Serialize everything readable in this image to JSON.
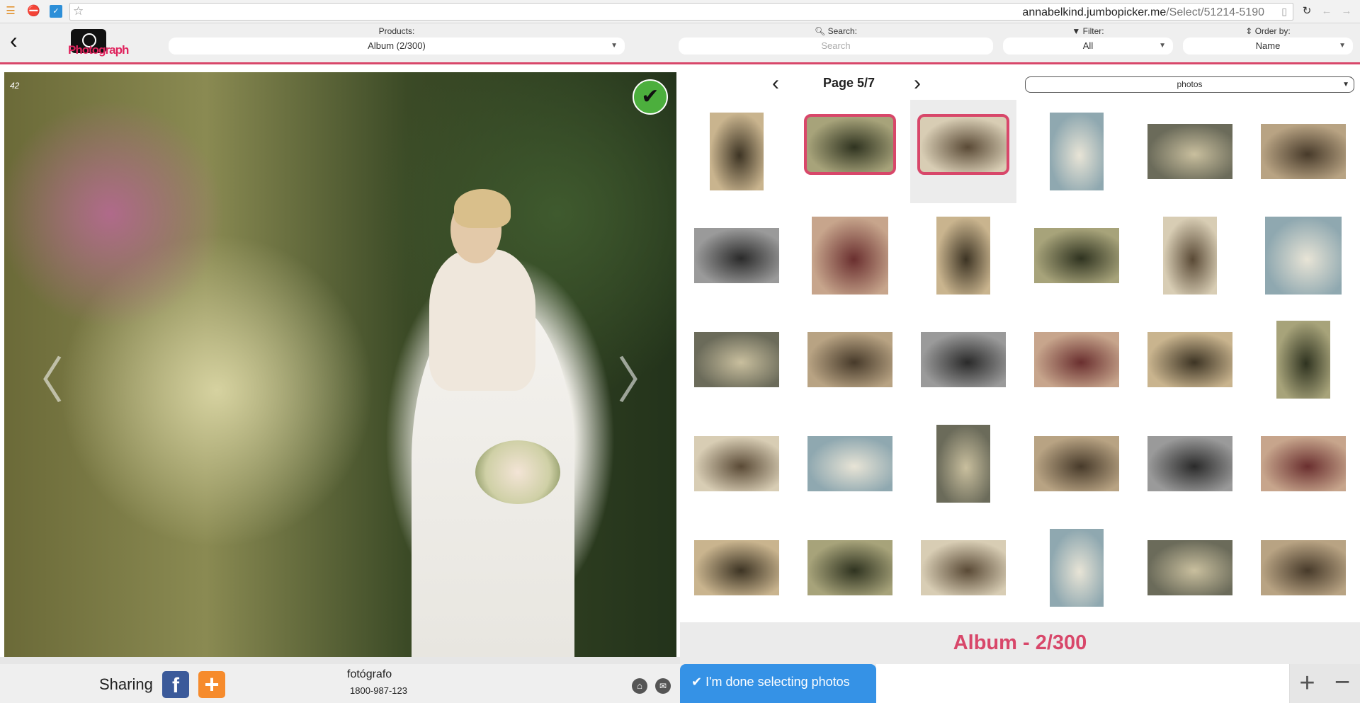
{
  "browser": {
    "url_host": "annabelkind.jumbopicker.me",
    "url_path": "/Select/51214-5190"
  },
  "header": {
    "products_label": "Products:",
    "products_value": "Album (2/300)",
    "search_label": "Search:",
    "search_placeholder": "Search",
    "filter_label": "Filter:",
    "filter_value": "All",
    "order_label": "Order by:",
    "order_value": "Name",
    "logo_text": "Photograph",
    "accent": "#d8476a"
  },
  "viewer": {
    "photo_number": "42",
    "selected": true
  },
  "gallery": {
    "page_label": "Page 5/7",
    "view_select": "photos",
    "rows": [
      [
        {
          "o": "p"
        },
        {
          "o": "l",
          "sel": true
        },
        {
          "o": "l",
          "sel": true,
          "current": true
        },
        {
          "o": "p"
        },
        {
          "o": "l"
        },
        {
          "o": "l"
        }
      ],
      [
        {
          "o": "l"
        },
        {
          "o": "s"
        },
        {
          "o": "p"
        },
        {
          "o": "l"
        },
        {
          "o": "p"
        },
        {
          "o": "s"
        }
      ],
      [
        {
          "o": "l"
        },
        {
          "o": "l"
        },
        {
          "o": "l"
        },
        {
          "o": "l"
        },
        {
          "o": "l"
        },
        {
          "o": "p"
        }
      ],
      [
        {
          "o": "l"
        },
        {
          "o": "l"
        },
        {
          "o": "p"
        },
        {
          "o": "l"
        },
        {
          "o": "l"
        },
        {
          "o": "l"
        }
      ],
      [
        {
          "o": "l"
        },
        {
          "o": "l"
        },
        {
          "o": "l"
        },
        {
          "o": "p"
        },
        {
          "o": "l"
        },
        {
          "o": "l"
        }
      ]
    ]
  },
  "album_status": "Album - 2/300",
  "footer": {
    "sharing_label": "Sharing",
    "photographer": "fotógrafo",
    "phone": "1800-987-123",
    "done_label": "I'm done selecting photos",
    "done_color": "#3592e6"
  }
}
